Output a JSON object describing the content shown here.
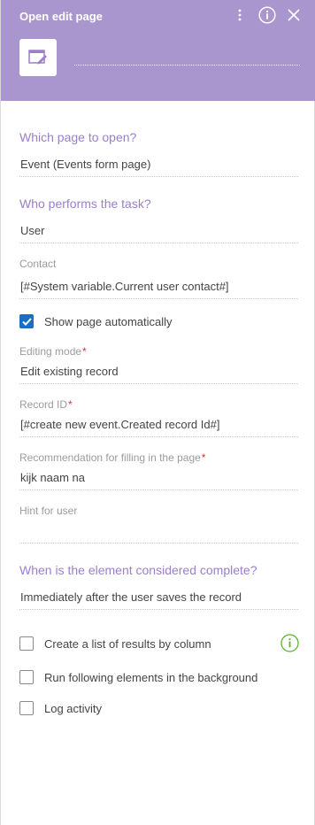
{
  "header": {
    "title": "Open edit page",
    "info_symbol": "i",
    "icons": [
      "more-vertical-icon",
      "info-icon",
      "close-icon",
      "edit-page-icon"
    ],
    "bg_color": "#a996cf"
  },
  "form": {
    "page_section": "Which page to open?",
    "page_value": "Event (Events form page)",
    "performer_section": "Who performs the task?",
    "performer_value": "User",
    "contact_label": "Contact",
    "contact_value": "[#System variable.Current user contact#]",
    "show_page_label": "Show page automatically",
    "show_page_checked": true,
    "editing_mode_label": "Editing mode",
    "editing_mode_value": "Edit existing record",
    "record_id_label": "Record ID",
    "record_id_value": "[#create new event.Created record Id#]",
    "recommendation_label": "Recommendation for filling in the page",
    "recommendation_value": "kijk naam na",
    "hint_label": "Hint for user",
    "hint_value": "",
    "required_mark": "*",
    "complete_section": "When is the element considered complete?",
    "complete_value": "Immediately after the user saves the record",
    "results_list_label": "Create a list of results by column",
    "results_list_checked": false,
    "background_label": "Run following elements in the background",
    "background_checked": false,
    "log_activity_label": "Log activity",
    "log_activity_checked": false
  },
  "colors": {
    "section_heading": "#9a7fcb",
    "checkbox_checked": "#1b6ec2",
    "required": "#e0332b",
    "info_green": "#5cb531"
  }
}
